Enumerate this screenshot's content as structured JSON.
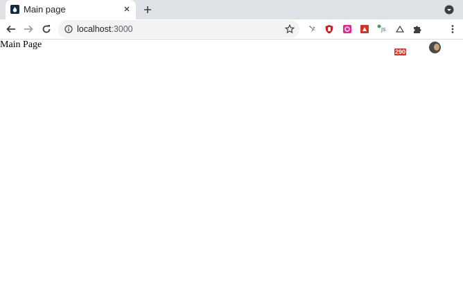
{
  "tab": {
    "title": "Main page",
    "favicon": "drop-icon"
  },
  "address_bar": {
    "host": "localhost",
    "port": ":3000"
  },
  "extensions": {
    "badge_count": "290",
    "js_label": "js"
  },
  "page": {
    "heading": "Main Page"
  },
  "colors": {
    "tabstrip": "#dee1e6",
    "omnibox": "#f1f3f4",
    "badge": "#d93025"
  }
}
